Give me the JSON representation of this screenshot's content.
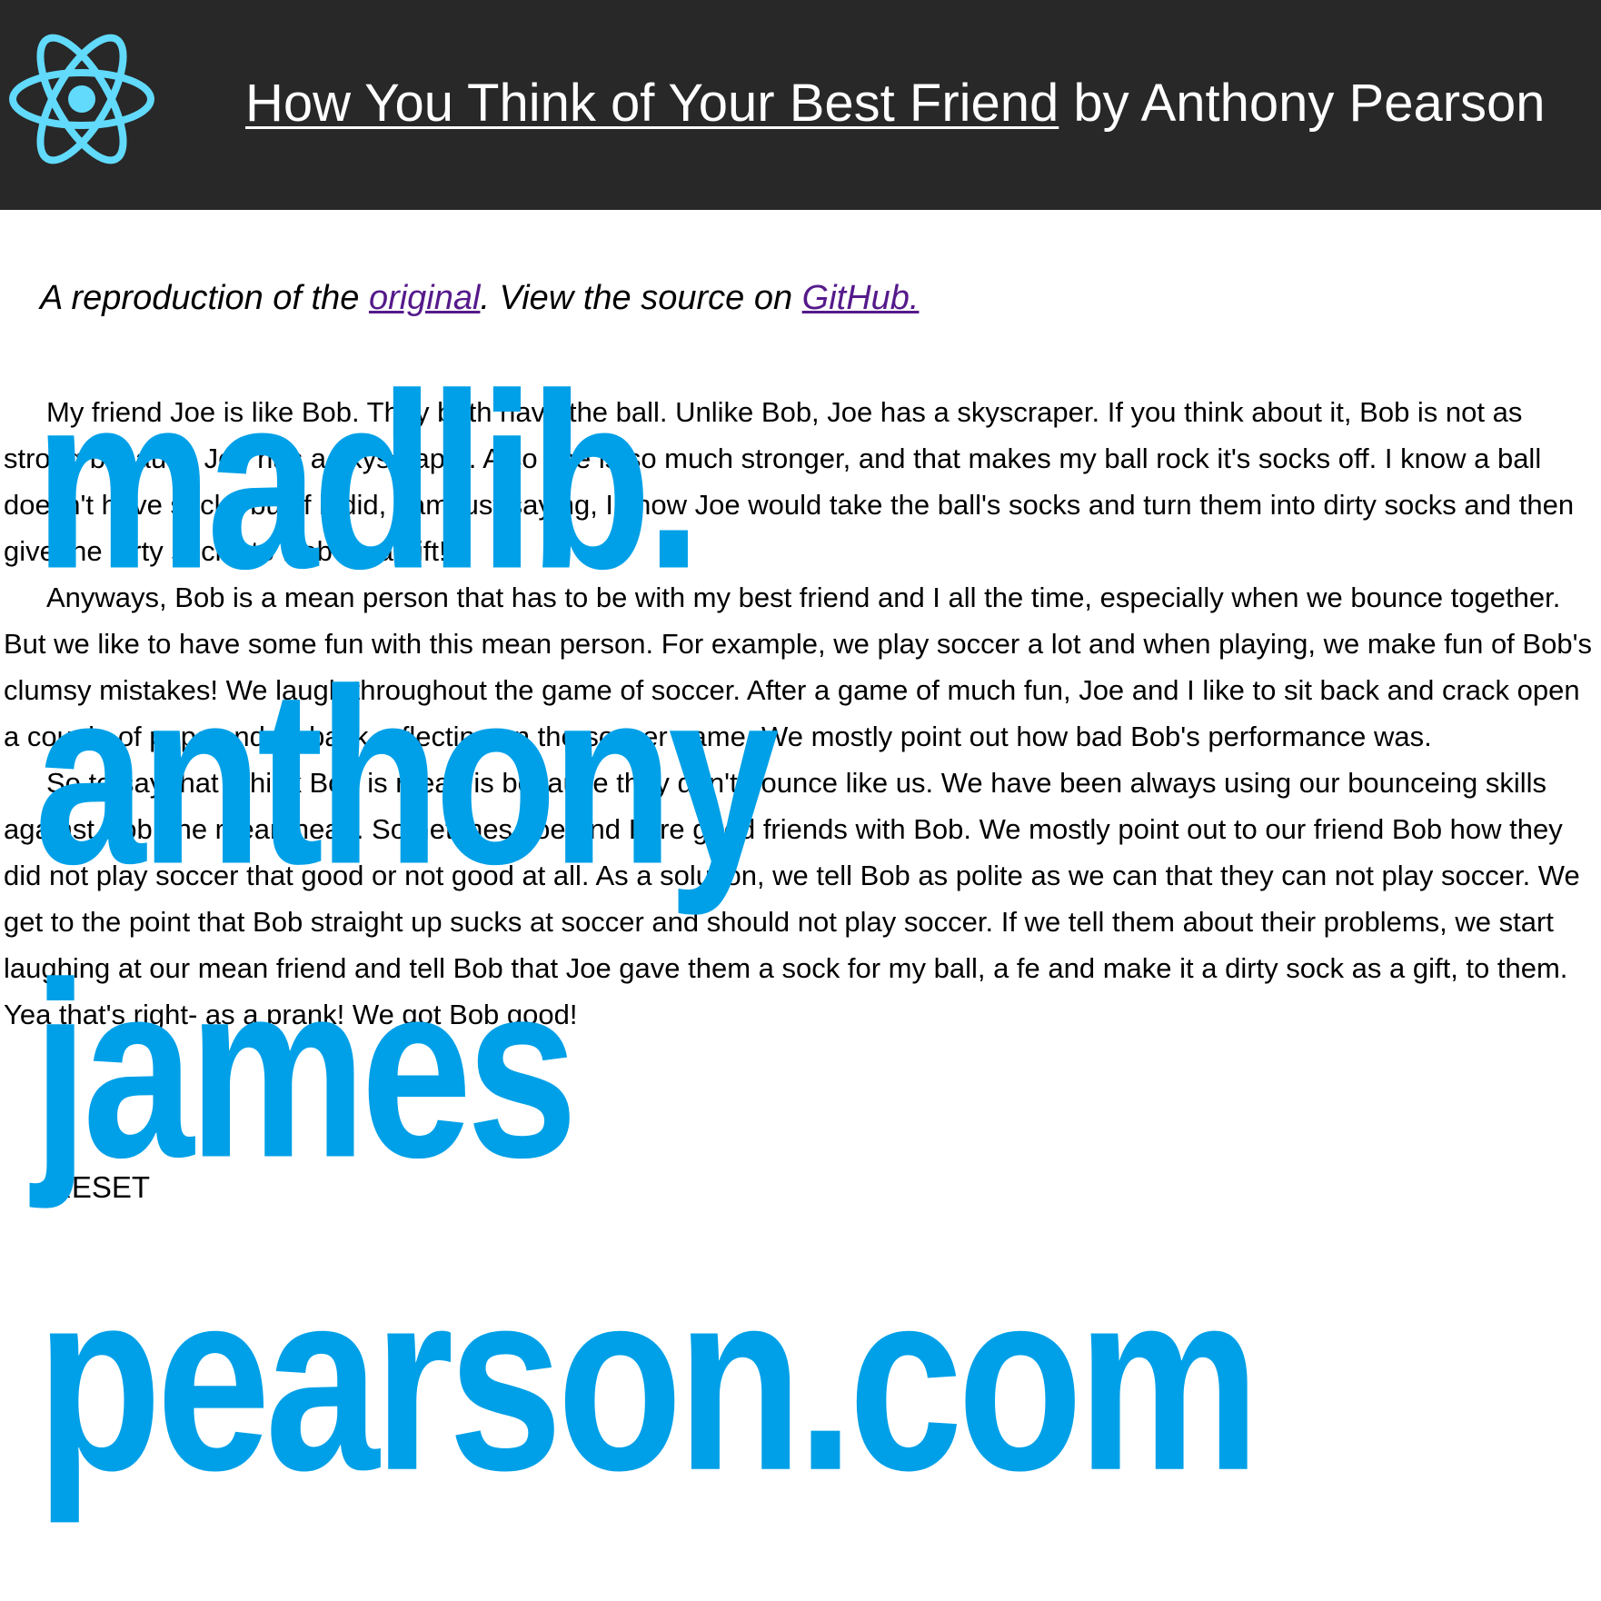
{
  "header": {
    "title_link": "How You Think of Your Best Friend",
    "title_suffix": " by Anthony Pearson",
    "logo_icon": "react-atom-icon",
    "background_color": "#282828",
    "logo_color": "#61dafb"
  },
  "subtitle": {
    "prefix": "A reproduction of the ",
    "original_link": "original",
    "middle": ". View the source on ",
    "github_link": "GitHub.",
    "link_color": "#551a8b"
  },
  "story": {
    "paragraphs": [
      "My friend Joe is like Bob. They both have the ball. Unlike Bob, Joe has a skyscraper. If you think about it, Bob is not as strong because Joe has a skyscraper. Also Joe is so much stronger, and that makes my ball rock it's socks off. I know a ball doesn't have socks but if it did, I am just saying, I know Joe would take the ball's socks and turn them into dirty socks and then give the dirty socks to Bob as a gift!",
      "Anyways, Bob is a mean person that has to be with my best friend and I all the time, especially when we bounce together. But we like to have some fun with this mean person. For example, we play soccer a lot and when playing, we make fun of Bob's clumsy mistakes! We laugh throughout the game of soccer. After a game of much fun, Joe and I like to sit back and crack open a couple of pops and sit back reflecting on the soccer game. We mostly point out how bad Bob's performance was.",
      "So to say that I think Bob is mean is because they don't bounce like us. We have been always using our bounceing skills against Bob, the mean head. Sometimes Joe and I are good friends with Bob. We mostly point out to our friend Bob how they did not play soccer that good or not good at all. As a solution, we tell Bob as polite as we can that they can not play soccer. We get to the point that  Bob straight up sucks at soccer and should not play soccer. If we tell them about their problems, we start laughing at our mean friend and tell Bob that Joe gave them a sock for my ball, a fe and make it a dirty sock as a gift, to them. Yea that's right- as a prank! We got Bob good!"
    ]
  },
  "reset_button": {
    "label": "RESET"
  },
  "watermark": {
    "line1": "madlib.",
    "line2": "anthony",
    "line3": "james",
    "line4": "pearson.com",
    "color": "#00a0e8"
  }
}
